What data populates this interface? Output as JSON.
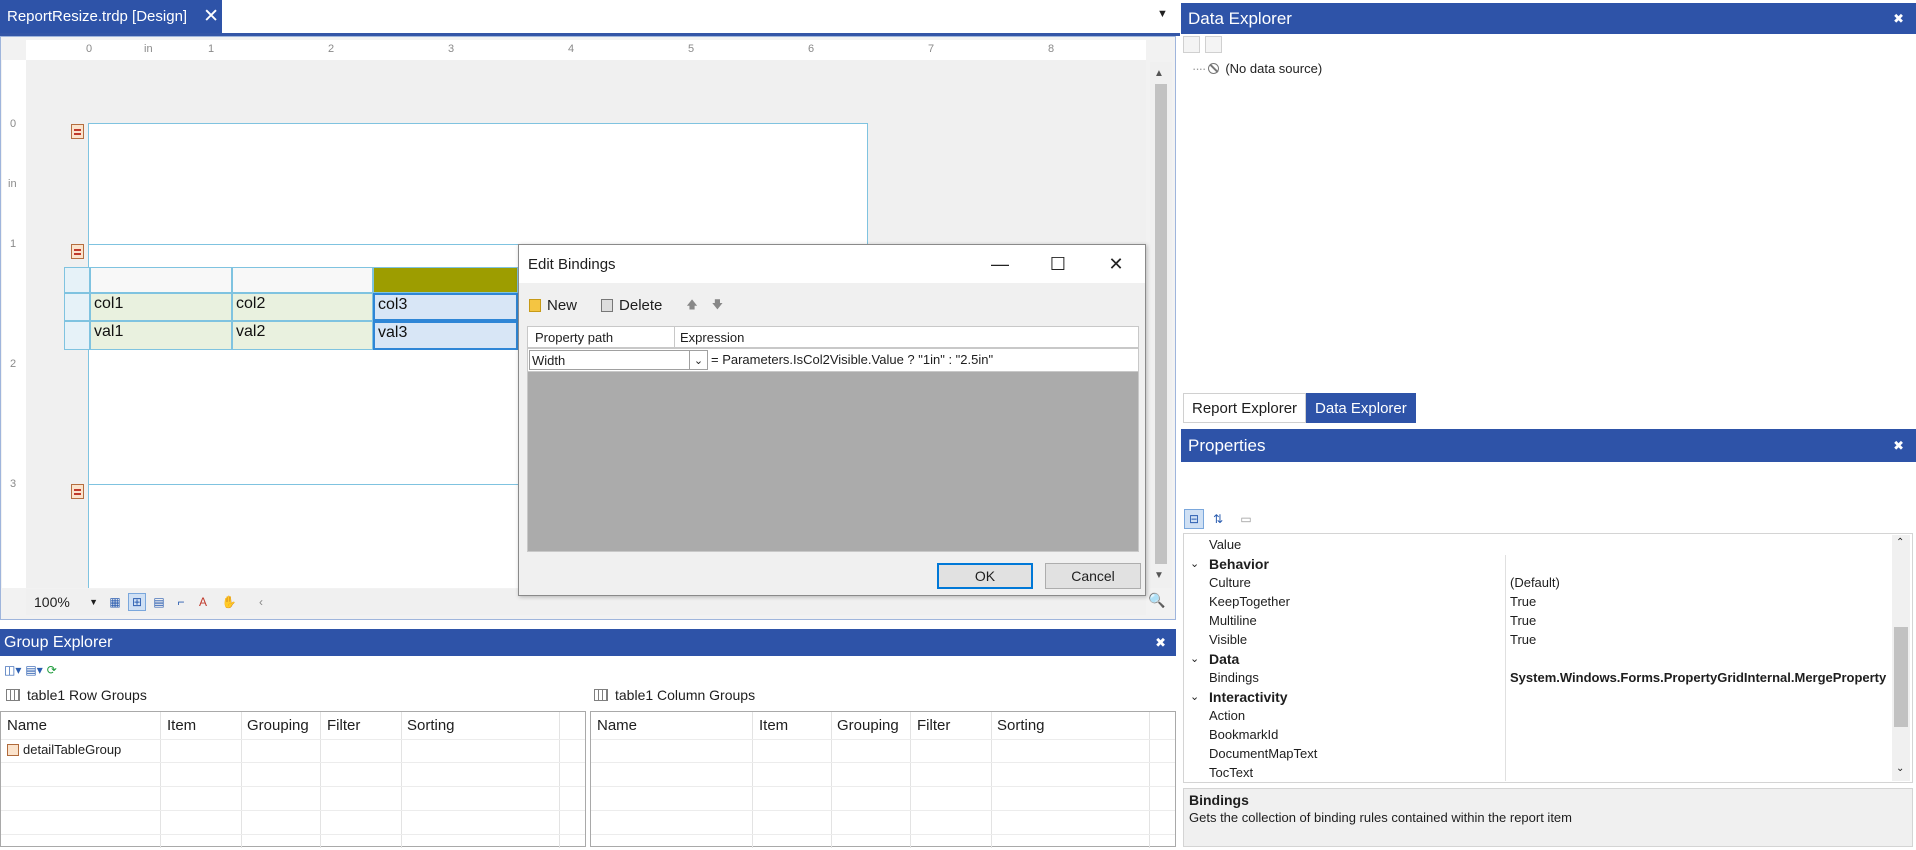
{
  "document_tab": {
    "title": "ReportResize.trdp [Design]",
    "close_icon": "close-icon"
  },
  "ruler": {
    "top_numbers": [
      "0",
      "in",
      "1",
      "2",
      "3",
      "4",
      "5",
      "6",
      "7",
      "8"
    ],
    "left_numbers": [
      "0",
      "in",
      "1",
      "2",
      "3"
    ]
  },
  "report_table": {
    "header_row": [
      "col1",
      "col2",
      "col3"
    ],
    "data_row": [
      "val1",
      "val2",
      "val3"
    ]
  },
  "designer_footer": {
    "zoom": "100%"
  },
  "edit_bindings": {
    "title": "Edit Bindings",
    "toolbar": {
      "new_label": "New",
      "delete_label": "Delete"
    },
    "columns": {
      "property_path": "Property path",
      "expression": "Expression"
    },
    "row": {
      "property": "Width",
      "expression": "= Parameters.IsCol2Visible.Value ? \"1in\" : \"2.5in\""
    },
    "ok_label": "OK",
    "cancel_label": "Cancel"
  },
  "group_explorer": {
    "title": "Group Explorer",
    "row_groups": {
      "label": "table1 Row Groups",
      "columns": [
        "Name",
        "Item",
        "Grouping",
        "Filter",
        "Sorting"
      ],
      "rows": [
        "detailTableGroup"
      ]
    },
    "column_groups": {
      "label": "table1 Column Groups",
      "columns": [
        "Name",
        "Item",
        "Grouping",
        "Filter",
        "Sorting"
      ]
    }
  },
  "data_explorer": {
    "title": "Data Explorer",
    "tree_item": "(No data source)"
  },
  "explorer_tabs": {
    "report": "Report Explorer",
    "data": "Data Explorer"
  },
  "properties": {
    "title": "Properties",
    "rows": [
      {
        "kind": "prop",
        "name": "Value",
        "value": ""
      },
      {
        "kind": "cat",
        "name": "Behavior"
      },
      {
        "kind": "prop",
        "name": "Culture",
        "value": "(Default)"
      },
      {
        "kind": "prop",
        "name": "KeepTogether",
        "value": "True"
      },
      {
        "kind": "prop",
        "name": "Multiline",
        "value": "True"
      },
      {
        "kind": "prop",
        "name": "Visible",
        "value": "True"
      },
      {
        "kind": "cat",
        "name": "Data"
      },
      {
        "kind": "prop",
        "name": "Bindings",
        "value": "System.Windows.Forms.PropertyGridInternal.MergeProperty",
        "bold": true
      },
      {
        "kind": "cat",
        "name": "Interactivity"
      },
      {
        "kind": "prop",
        "name": "Action",
        "value": ""
      },
      {
        "kind": "prop",
        "name": "BookmarkId",
        "value": ""
      },
      {
        "kind": "prop",
        "name": "DocumentMapText",
        "value": ""
      },
      {
        "kind": "prop",
        "name": "TocText",
        "value": ""
      }
    ],
    "description": {
      "title": "Bindings",
      "text": "Gets the collection of binding rules contained within the report item"
    }
  }
}
